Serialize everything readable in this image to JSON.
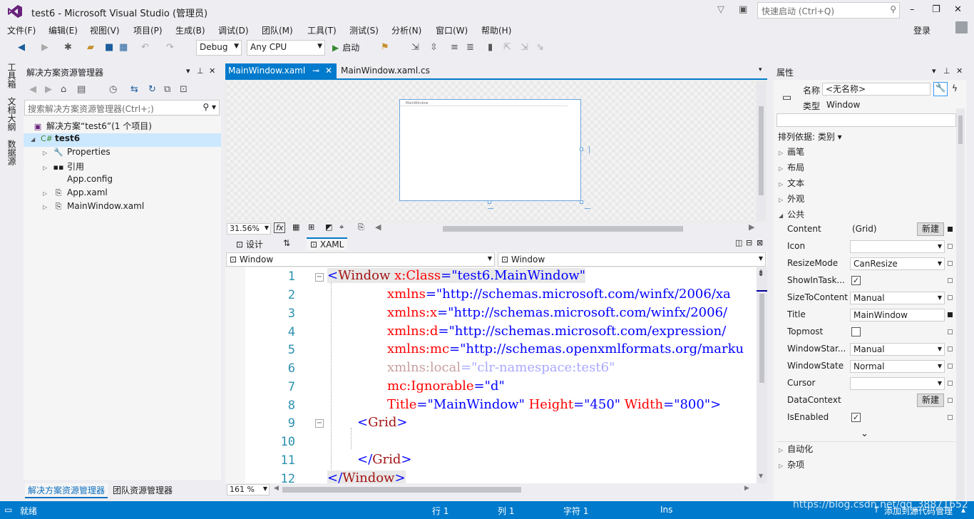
{
  "window": {
    "title": "test6 - Microsoft Visual Studio (管理员)",
    "quick_launch_placeholder": "快速启动 (Ctrl+Q)",
    "login": "登录"
  },
  "menu": [
    "文件(F)",
    "编辑(E)",
    "视图(V)",
    "项目(P)",
    "生成(B)",
    "调试(D)",
    "团队(M)",
    "工具(T)",
    "测试(S)",
    "分析(N)",
    "窗口(W)",
    "帮助(H)"
  ],
  "toolbar": {
    "config": "Debug",
    "platform": "Any CPU",
    "start": "启动"
  },
  "left_tabs": [
    "工具箱",
    "文档大纲",
    "数据源"
  ],
  "solution_explorer": {
    "title": "解决方案资源管理器",
    "search_placeholder": "搜索解决方案资源管理器(Ctrl+;)",
    "solution": "解决方案“test6”(1 个项目)",
    "project": "test6",
    "items": [
      "Properties",
      "引用",
      "App.config",
      "App.xaml",
      "MainWindow.xaml"
    ],
    "bottom_tabs": [
      "解决方案资源管理器",
      "团队资源管理器"
    ]
  },
  "doc_tabs": [
    "MainWindow.xaml",
    "MainWindow.xaml.cs"
  ],
  "designer": {
    "preview_title": "MainWindow",
    "zoom": "31.56%",
    "fx": "fx"
  },
  "split": {
    "design": "设计",
    "swap": "⇅",
    "xaml": "XAML"
  },
  "nav": {
    "left": "Window",
    "right": "Window"
  },
  "editor": {
    "line_numbers": [
      "1",
      "2",
      "3",
      "4",
      "5",
      "6",
      "7",
      "8",
      "9",
      "10",
      "11",
      "12"
    ],
    "l1": {
      "open": "<",
      "tag": "Window",
      "attr": " x:Class",
      "eq": "=",
      "val": "\"test6.MainWindow\""
    },
    "l2": {
      "attr": "xmlns",
      "eq": "=",
      "val": "\"http://schemas.microsoft.com/winfx/2006/xa"
    },
    "l3": {
      "attr": "xmlns:x",
      "eq": "=",
      "val": "\"http://schemas.microsoft.com/winfx/2006/"
    },
    "l4": {
      "attr": "xmlns:d",
      "eq": "=",
      "val": "\"http://schemas.microsoft.com/expression/"
    },
    "l5": {
      "attr": "xmlns:mc",
      "eq": "=",
      "val": "\"http://schemas.openxmlformats.org/marku"
    },
    "l6": {
      "attr": "xmlns:local",
      "eq": "=",
      "val": "\"clr-namespace:test6\""
    },
    "l7": {
      "attr": "mc:Ignorable",
      "eq": "=",
      "val": "\"d\""
    },
    "l8": {
      "a1": "Title",
      "v1": "\"MainWindow\"",
      "a2": " Height",
      "v2": "\"450\"",
      "a3": " Width",
      "v3": "\"800\"",
      "eq": "=",
      "close": ">"
    },
    "l9": {
      "open": "<",
      "tag": "Grid",
      "close": ">"
    },
    "l11": {
      "open": "</",
      "tag": "Grid",
      "close": ">"
    },
    "l12": {
      "open": "</",
      "tag": "Window",
      "close": ">"
    },
    "zoom": "161 %"
  },
  "properties": {
    "title": "属性",
    "name_label": "名称",
    "name_value": "<无名称>",
    "type_label": "类型",
    "type_value": "Window",
    "sort": "排列依据: 类别",
    "categories_top": [
      "画笔",
      "布局",
      "文本",
      "外观",
      "公共"
    ],
    "rows": [
      {
        "label": "Content",
        "value": "(Grid)",
        "button": "新建"
      },
      {
        "label": "Icon",
        "value": ""
      },
      {
        "label": "ResizeMode",
        "value": "CanResize"
      },
      {
        "label": "ShowInTask...",
        "value": "✓"
      },
      {
        "label": "SizeToContent",
        "value": "Manual"
      },
      {
        "label": "Title",
        "value": "MainWindow"
      },
      {
        "label": "Topmost",
        "value": ""
      },
      {
        "label": "WindowStar...",
        "value": "Manual"
      },
      {
        "label": "WindowState",
        "value": "Normal"
      },
      {
        "label": "Cursor",
        "value": ""
      },
      {
        "label": "DataContext",
        "value": "",
        "button": "新建"
      },
      {
        "label": "IsEnabled",
        "value": "✓"
      }
    ],
    "categories_bottom": [
      "自动化",
      "杂项"
    ]
  },
  "status": {
    "ready": "就绪",
    "row": "行 1",
    "col": "列 1",
    "char": "字符 1",
    "ins": "Ins",
    "source": "添加到源代码管理",
    "watermark": "https://blog.csdn.net/qq_38871652"
  },
  "colors": {
    "accent": "#007acc",
    "tag": "#a31515",
    "attr": "#ff0000",
    "value": "#0000ff",
    "line_number": "#2b91af"
  }
}
